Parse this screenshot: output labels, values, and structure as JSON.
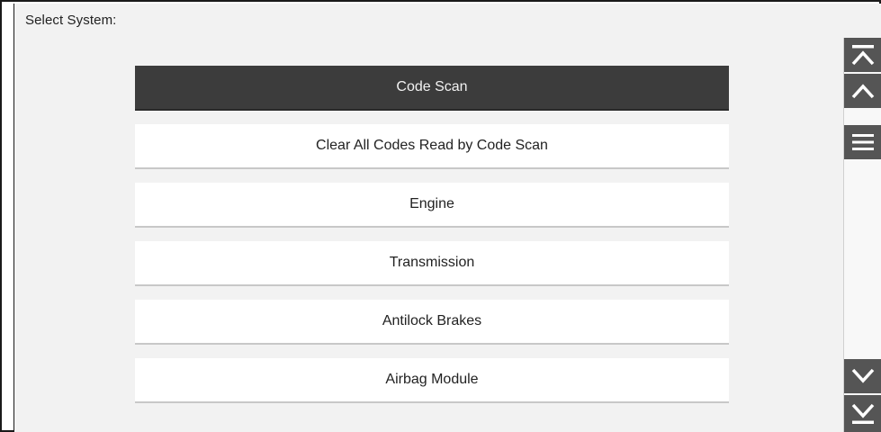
{
  "header": {
    "title": "Select System:"
  },
  "menu": {
    "items": [
      {
        "label": "Code Scan",
        "selected": true
      },
      {
        "label": "Clear All Codes Read by Code Scan",
        "selected": false
      },
      {
        "label": "Engine",
        "selected": false
      },
      {
        "label": "Transmission",
        "selected": false
      },
      {
        "label": "Antilock Brakes",
        "selected": false
      },
      {
        "label": "Airbag Module",
        "selected": false
      }
    ]
  },
  "scrollbar": {
    "icons": [
      "scroll-top-icon",
      "scroll-up-icon",
      "scroll-thumb-icon",
      "scroll-down-icon",
      "scroll-bottom-icon"
    ]
  },
  "colors": {
    "selected_bg": "#3c3c3c",
    "item_bg": "#ffffff",
    "screen_bg": "#f2f2f2",
    "scroll_button": "#555555"
  }
}
